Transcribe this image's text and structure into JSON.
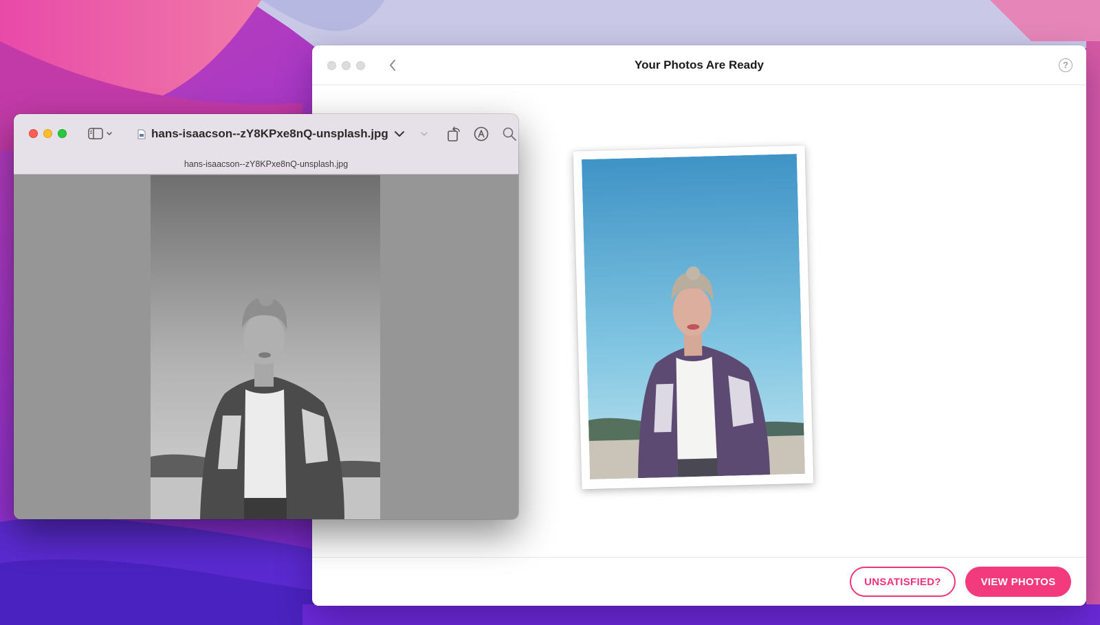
{
  "app_window": {
    "title": "Your Photos Are Ready",
    "help_glyph": "?",
    "buttons": {
      "unsatisfied": "UNSATISFIED?",
      "view_photos": "VIEW PHOTOS"
    },
    "accent_color": "#f23a7c"
  },
  "preview_window": {
    "file_name": "hans-isaacson--zY8KPxe8nQ-unsplash.jpg",
    "subtitle": "hans-isaacson--zY8KPxe8nQ-unsplash.jpg",
    "icons": [
      "sidebar-toggle-icon",
      "document-icon",
      "rotate-icon",
      "markup-icon",
      "search-icon"
    ]
  }
}
